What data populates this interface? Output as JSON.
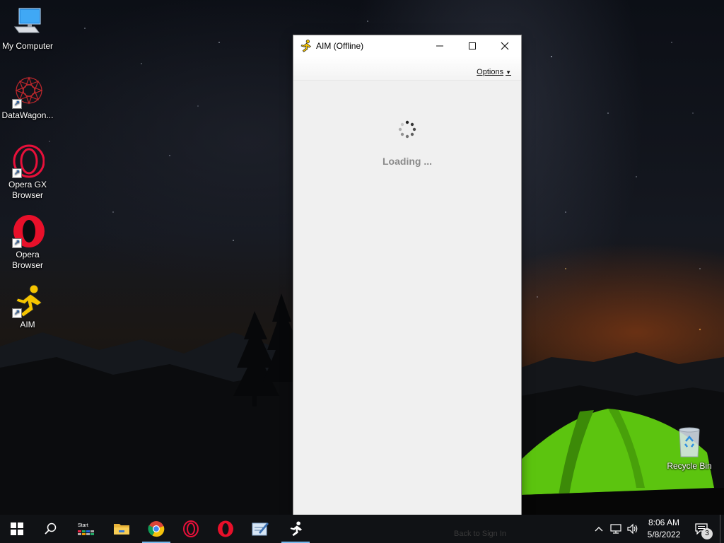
{
  "desktop": {
    "icons": [
      {
        "label": "My Computer"
      },
      {
        "label": "DataWagon..."
      },
      {
        "label": "Opera GX Browser"
      },
      {
        "label": "Opera Browser"
      },
      {
        "label": "AIM"
      },
      {
        "label": "Recycle Bin"
      }
    ]
  },
  "window": {
    "title": "AIM (Offline)",
    "controls": {
      "minimize": "─",
      "maximize": "☐",
      "close": "✕"
    },
    "options_label": "Options",
    "loading_text": "Loading ..."
  },
  "taskbar": {
    "start_tile_label": "Start",
    "ghost_label": "Back to Sign In",
    "clock": {
      "time": "8:06 AM",
      "date": "5/8/2022"
    },
    "notification_count": "3",
    "icons": [
      "windows-start-icon",
      "search-icon",
      "start-tile-icon",
      "file-explorer-icon",
      "chrome-icon",
      "opera-gx-icon",
      "opera-icon",
      "notepad-icon",
      "aim-running-man-icon"
    ]
  },
  "colors": {
    "aim_yellow": "#f5c400",
    "opera_red": "#e8102a",
    "tent_green": "#6ad31a",
    "taskbar": "#101215",
    "active_indicator": "#76b9ed"
  }
}
